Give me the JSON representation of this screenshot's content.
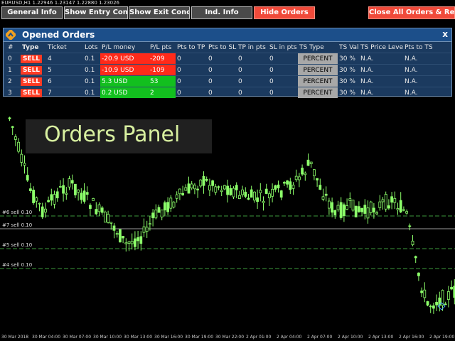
{
  "toolbar": {
    "buttons": [
      "General Info",
      "Show Entry Cond.",
      "Show Exit Cond.",
      "Ind. Info",
      "Hide Orders"
    ],
    "close_all": "Close All Orders & Reset"
  },
  "chart": {
    "symbol_info": "EURUSD,H1  1.22946 1.23147 1.22880 1.23026",
    "levels": [
      {
        "label": "#6 sell 0.10",
        "style": "dashed"
      },
      {
        "label": "#7 sell 0.10",
        "style": "solid"
      },
      {
        "label": "#5 sell 0.10",
        "style": "dashed"
      },
      {
        "label": "#4 sell 0.10",
        "style": "dashed"
      }
    ],
    "dates": [
      "30 Mar 2018",
      "30 Mar 04:00",
      "30 Mar 07:00",
      "30 Mar 10:00",
      "30 Mar 13:00",
      "30 Mar 16:00",
      "30 Mar 19:00",
      "30 Mar 22:00",
      "2 Apr 01:00",
      "2 Apr 04:00",
      "2 Apr 07:00",
      "2 Apr 10:00",
      "2 Apr 13:00",
      "2 Apr 16:00",
      "2 Apr 19:00"
    ]
  },
  "panel": {
    "title": "Opened Orders",
    "close": "x",
    "columns": [
      "#",
      "Type",
      "Ticket",
      "Lots",
      "P/L money",
      "P/L pts",
      "Pts to TP",
      "Pts to SL",
      "TP in pts",
      "SL in pts",
      "TS Type",
      "TS Val",
      "TS Price Level",
      "Pts to TS"
    ],
    "rows": [
      {
        "n": "0",
        "type": "SELL",
        "ticket": "4",
        "lots": "0.1",
        "pl_money": "-20.9 USD",
        "pl_pts": "-209",
        "pts_tp": "0",
        "pts_sl": "0",
        "tp_pts": "0",
        "sl_pts": "0",
        "ts_type": "PERCENT",
        "ts_val": "30 %",
        "ts_price": "N.A.",
        "pts_ts": "N.A."
      },
      {
        "n": "1",
        "type": "SELL",
        "ticket": "5",
        "lots": "0.1",
        "pl_money": "-10.9 USD",
        "pl_pts": "-109",
        "pts_tp": "0",
        "pts_sl": "0",
        "tp_pts": "0",
        "sl_pts": "0",
        "ts_type": "PERCENT",
        "ts_val": "30 %",
        "ts_price": "N.A.",
        "pts_ts": "N.A."
      },
      {
        "n": "2",
        "type": "SELL",
        "ticket": "6",
        "lots": "0.1",
        "pl_money": "5.3 USD",
        "pl_pts": "53",
        "pts_tp": "0",
        "pts_sl": "0",
        "tp_pts": "0",
        "sl_pts": "0",
        "ts_type": "PERCENT",
        "ts_val": "30 %",
        "ts_price": "N.A.",
        "pts_ts": "N.A."
      },
      {
        "n": "3",
        "type": "SELL",
        "ticket": "7",
        "lots": "0.1",
        "pl_money": "0.2 USD",
        "pl_pts": "2",
        "pts_tp": "0",
        "pts_sl": "0",
        "tp_pts": "0",
        "sl_pts": "0",
        "ts_type": "PERCENT",
        "ts_val": "30 %",
        "ts_price": "N.A.",
        "pts_ts": "N.A."
      }
    ]
  },
  "overlay": {
    "text": "Orders Panel"
  }
}
